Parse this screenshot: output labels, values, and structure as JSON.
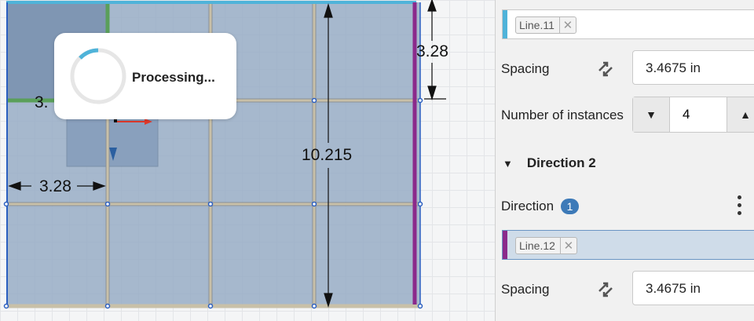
{
  "canvas": {
    "dimensions": {
      "dim_top_right": "3.28",
      "dim_left": "3.28",
      "dim_height": "10.215",
      "dim_partial": "3."
    },
    "toast": {
      "text": "Processing..."
    }
  },
  "panel": {
    "direction1_field": {
      "chip": "Line.11",
      "remove": "✕",
      "accent_color": "#4fb3d9"
    },
    "spacing1": {
      "label": "Spacing",
      "value": "3.4675 in"
    },
    "instances": {
      "label": "Number of instances",
      "value": "4",
      "decrement": "▼",
      "increment": "▲"
    },
    "direction2": {
      "toggle": "▼",
      "title": "Direction 2"
    },
    "direction2_dir": {
      "label": "Direction",
      "badge": "1"
    },
    "direction2_field": {
      "chip": "Line.12",
      "remove": "✕",
      "accent_color": "#8b2a8b"
    },
    "spacing2": {
      "label": "Spacing",
      "value": "3.4675 in"
    }
  },
  "colors": {
    "sketch_fill": "#9aaec6",
    "selected_line": "#8b2a8b",
    "edge_blue": "#2b5fc0",
    "arrow_red": "#e0392b"
  }
}
